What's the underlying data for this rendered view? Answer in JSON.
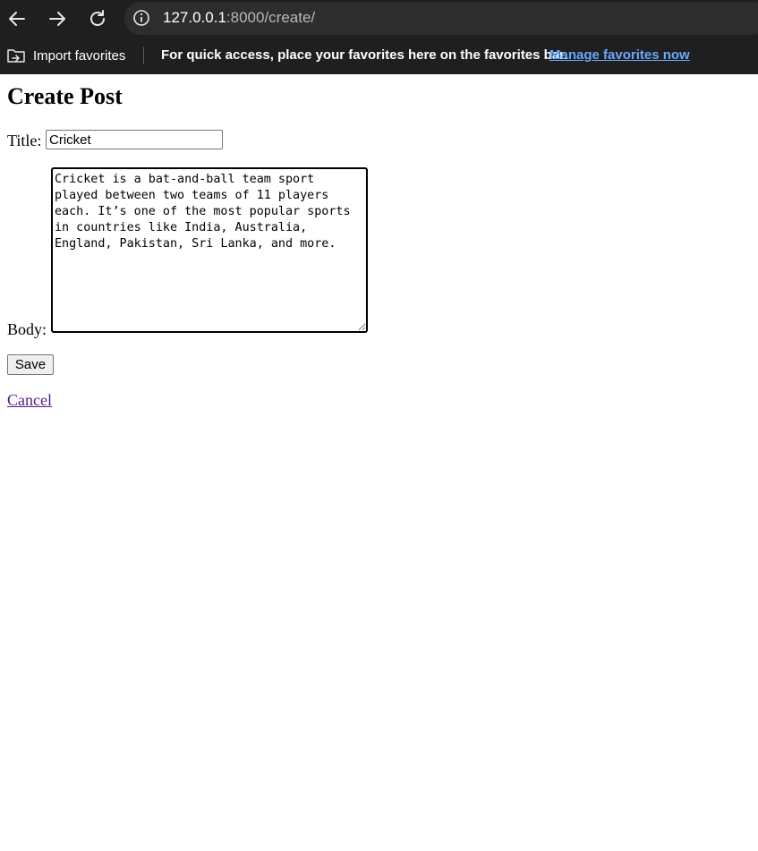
{
  "browser": {
    "url_host": "127.0.0.1",
    "url_rest": ":8000/create/",
    "favorites_bar": {
      "import_label": "Import favorites",
      "message": "For quick access, place your favorites here on the favorites bar.",
      "manage_link": "Manage favorites now"
    }
  },
  "page": {
    "heading": "Create Post",
    "form": {
      "title_label": "Title:",
      "title_value": "Cricket",
      "body_label": "Body:",
      "body_value": "Cricket is a bat-and-ball team sport played between two teams of 11 players each. It’s one of the most popular sports in countries like India, Australia, England, Pakistan, Sri Lanka, and more.",
      "save_label": "Save",
      "cancel_label": "Cancel"
    }
  }
}
